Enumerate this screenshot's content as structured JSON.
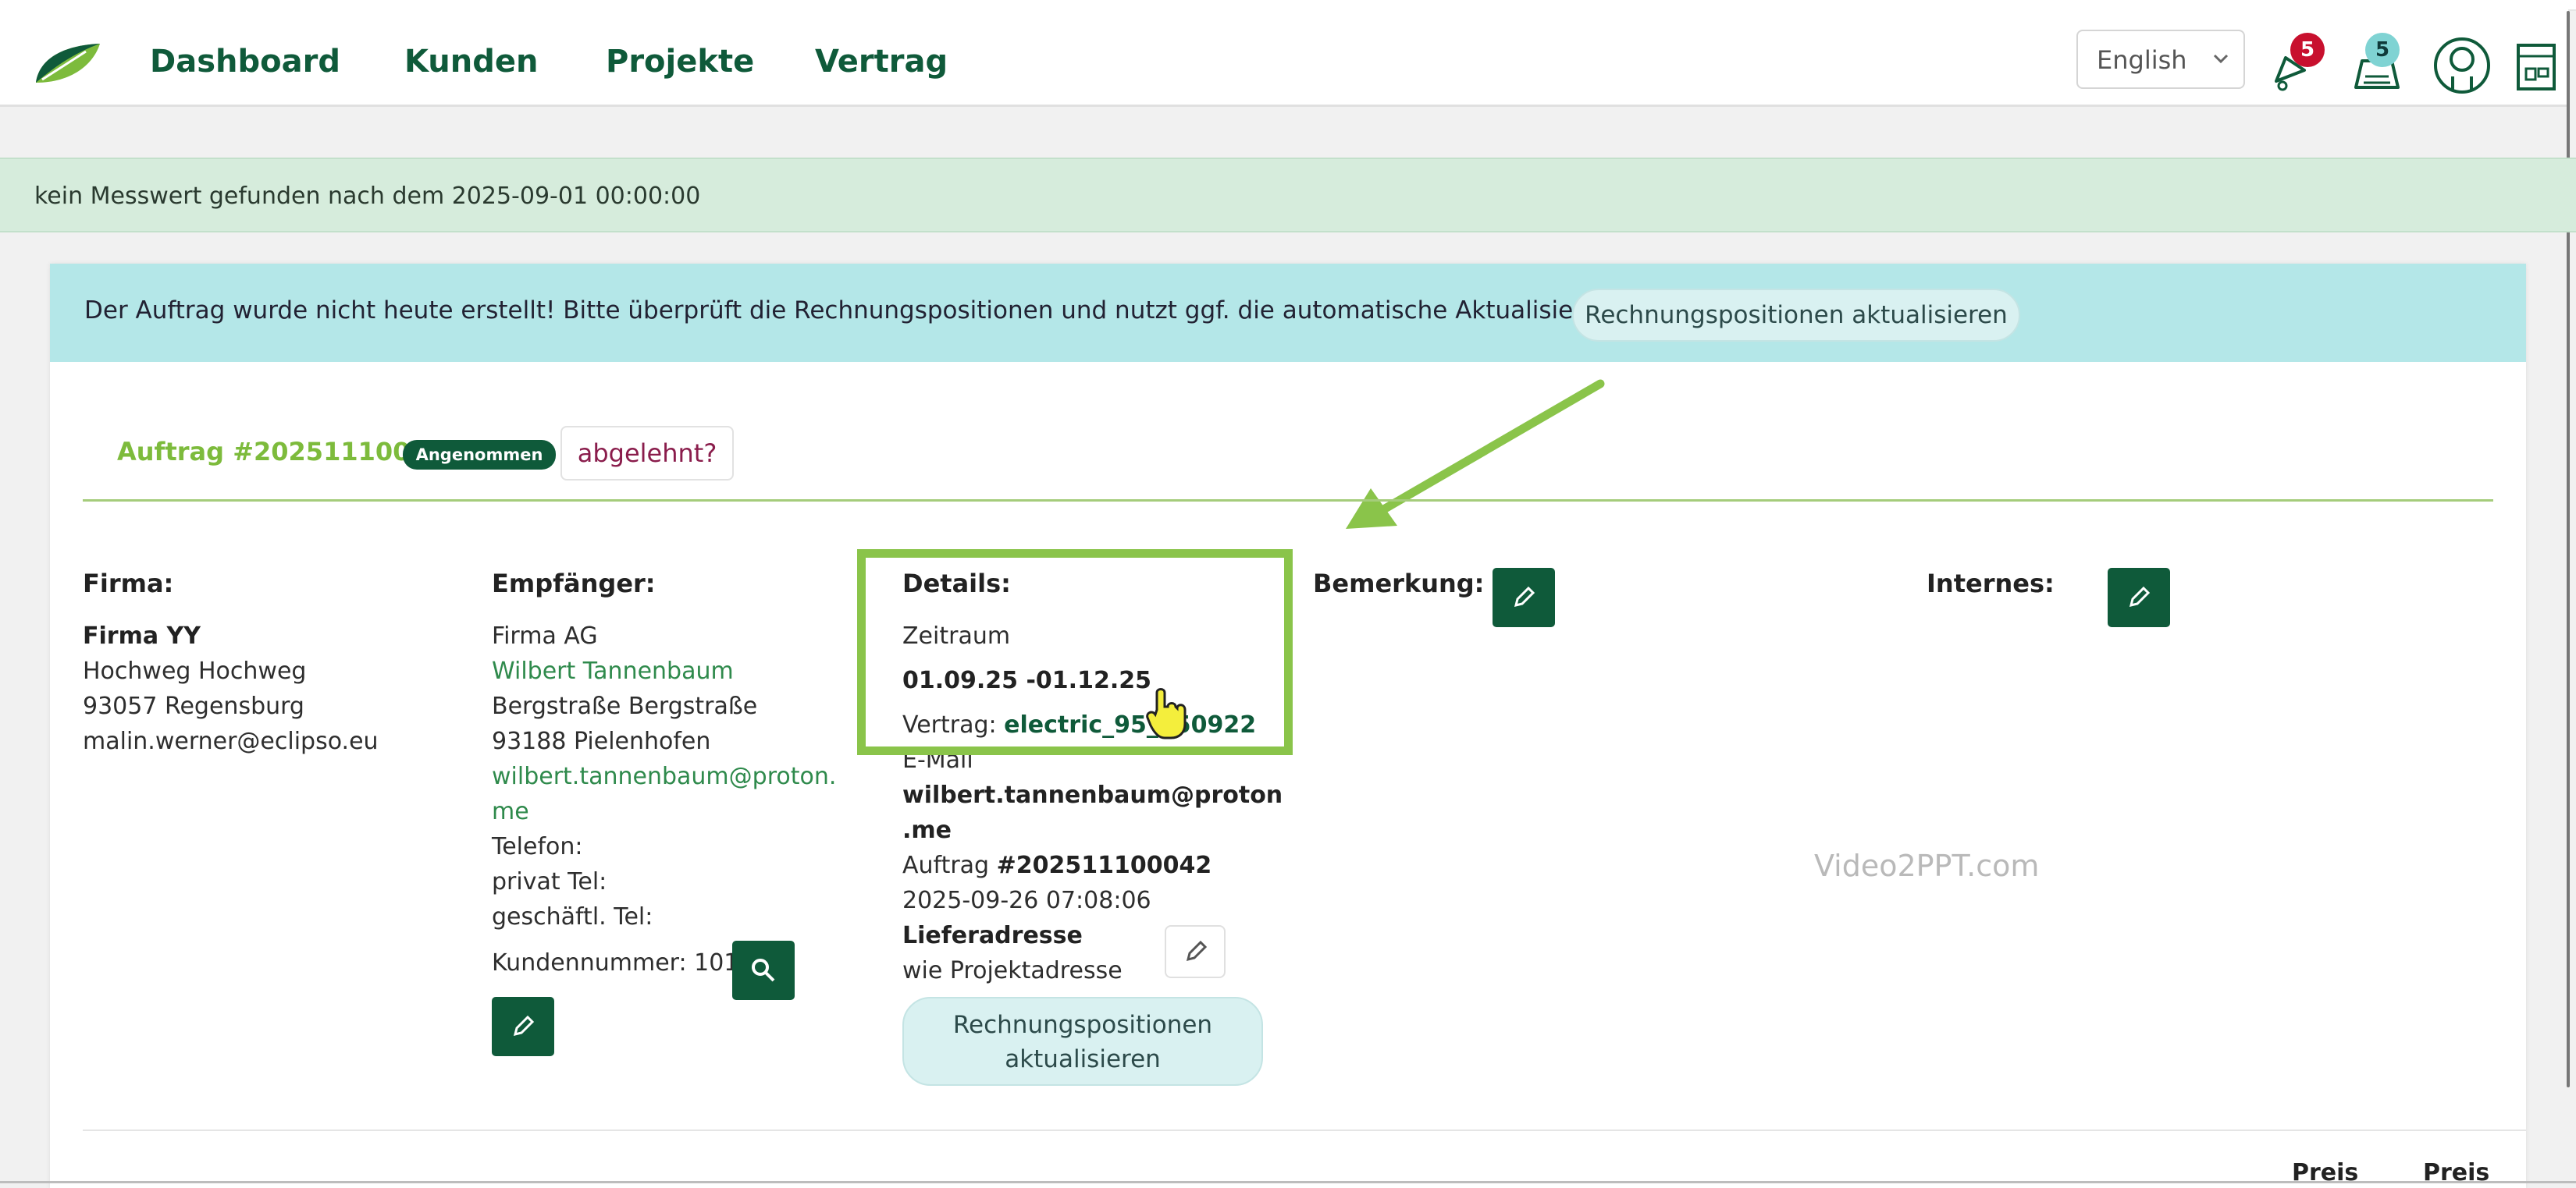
{
  "nav": {
    "links": [
      "Dashboard",
      "Kunden",
      "Projekte",
      "Vertrag"
    ],
    "language": "English",
    "notification_count": "5",
    "task_count": "5"
  },
  "alerts": {
    "success": "kein Messwert gefunden nach dem 2025-09-01 00:00:00",
    "info": "Der Auftrag wurde nicht heute erstellt! Bitte überprüft die Rechnungspositionen und nutzt ggf. die automatische Aktualisierung.",
    "info_button": "Rechnungspositionen aktualisieren"
  },
  "order": {
    "title": "Auftrag #202511100042",
    "status": "Angenommen",
    "reject_label": "abgelehnt?"
  },
  "firma": {
    "heading": "Firma:",
    "name": "Firma YY",
    "street": "Hochweg Hochweg",
    "city": "93057 Regensburg",
    "email": "malin.werner@eclipso.eu"
  },
  "empfaenger": {
    "heading": "Empfänger:",
    "company": "Firma AG",
    "contact": "Wilbert Tannenbaum",
    "street": "Bergstraße Bergstraße",
    "city": "93188 Pielenhofen",
    "email_line1": "wilbert.tannenbaum@proton.",
    "email_line2": "me",
    "phone_label": "Telefon:",
    "private_phone_label": "privat Tel:",
    "business_phone_label": "geschäftl. Tel:",
    "customer_number": "Kundennummer: 101"
  },
  "details": {
    "heading": "Details:",
    "period_label": "Zeitraum",
    "period_value": "01.09.25 -01.12.25",
    "contract_label": "Vertrag:",
    "contract_value": "electric_95_250922",
    "email_label": "E-Mail",
    "email_line1": "wilbert.tannenbaum@proton",
    "email_line2": ".me",
    "order_label": "Auftrag",
    "order_value": "#202511100042",
    "datetime": "2025-09-26 07:08:06",
    "delivery_label": "Lieferadresse",
    "delivery_value": "wie Projektadresse",
    "update_line1": "Rechnungspositionen",
    "update_line2": "aktualisieren"
  },
  "remarks": {
    "bemerkung": "Bemerkung:",
    "internes": "Internes:"
  },
  "watermark": "Video2PPT.com",
  "table_headers": [
    "Preis",
    "Preis"
  ],
  "colors": {
    "brand_dark_green": "#0f5a3a",
    "accent_lime": "#8ac44a",
    "info_teal": "#b4e7e8",
    "success_green": "#d6ecdc",
    "badge_red": "#c8102e",
    "badge_teal": "#7fd3d3"
  }
}
